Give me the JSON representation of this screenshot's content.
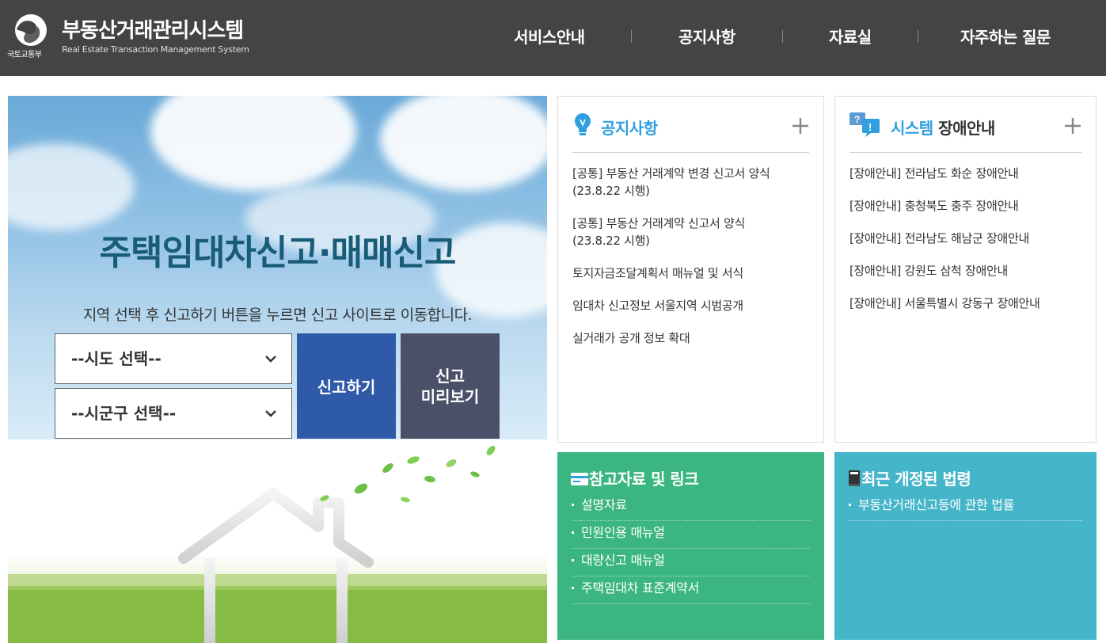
{
  "header": {
    "logo_ministry": "국토교통부",
    "logo_title": "부동산거래관리시스템",
    "logo_subtitle": "Real Estate Transaction Management System",
    "nav": [
      {
        "label": "서비스안내"
      },
      {
        "label": "공지사항"
      },
      {
        "label": "자료실"
      },
      {
        "label": "자주하는 질문"
      }
    ]
  },
  "hero": {
    "title": "주택임대차신고·매매신고",
    "description": "지역 선택 후 신고하기 버튼을 누르면 신고 사이트로 이동합니다.",
    "select_sido": "--시도 선택--",
    "select_sigungu": "--시군구 선택--",
    "report_button": "신고하기",
    "preview_button_line1": "신고",
    "preview_button_line2": "미리보기"
  },
  "notice": {
    "title": "공지사항",
    "items": [
      {
        "line1": "[공통] 부동산 거래계약 변경 신고서 양식",
        "line2": "(23.8.22 시행)"
      },
      {
        "line1": "[공통] 부동산 거래계약 신고서 양식",
        "line2": "(23.8.22 시행)"
      },
      {
        "line1": "토지자금조달계획서 매뉴얼 및 서식",
        "line2": ""
      },
      {
        "line1": "임대차 신고정보 서울지역 시범공개",
        "line2": ""
      },
      {
        "line1": "실거래가 공개 정보 확대",
        "line2": ""
      }
    ]
  },
  "outage": {
    "title_part1": "시스템",
    "title_part2": "장애안내",
    "items": [
      "[장애안내] 전라남도 화순 장애안내",
      "[장애안내] 충청북도 충주 장애안내",
      "[장애안내] 전라남도 해남군 장애안내",
      "[장애안내] 강원도 삼척 장애안내",
      "[장애안내] 서울특별시 강동구 장애안내"
    ]
  },
  "references": {
    "title": "참고자료 및 링크",
    "items": [
      "설명자료",
      "민원인용 매뉴얼",
      "대량신고 매뉴얼",
      "주택임대차 표준계약서"
    ],
    "color": "#3bb680"
  },
  "laws": {
    "title": "최근 개정된 법령",
    "items": [
      "부동산거래신고등에 관한 법률"
    ],
    "color": "#45b5c9"
  },
  "colors": {
    "header_bg": "#444444",
    "accent_blue": "#2f9fe0",
    "report_button": "#2f5aa7",
    "preview_button": "#4a5068",
    "hero_title": "#195c77"
  },
  "icons": {
    "notice": "lightbulb-icon",
    "outage": "question-exclamation-icon",
    "references": "card-icon",
    "laws": "book-icon",
    "plus": "plus-icon",
    "chevron": "chevron-down-icon"
  }
}
